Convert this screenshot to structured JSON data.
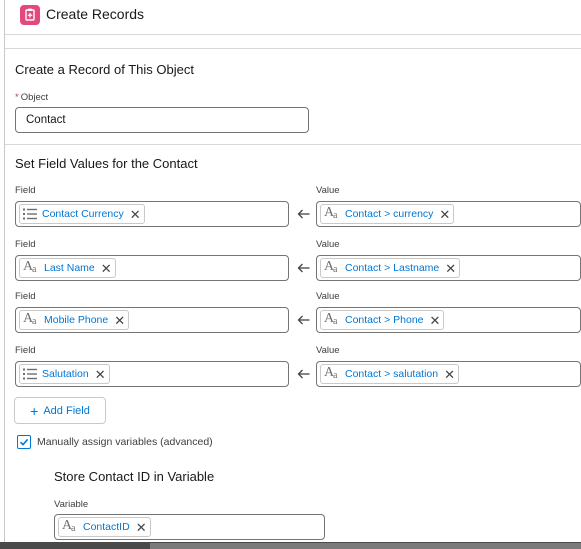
{
  "header": {
    "title": "Create Records",
    "icon": "create-records-icon",
    "icon_color": "#e5477f"
  },
  "object_section": {
    "title": "Create a Record of This Object",
    "object_label": "Object",
    "required_marker": "*",
    "object_value": "Contact"
  },
  "fields_section": {
    "title": "Set Field Values for the Contact",
    "field_label": "Field",
    "value_label": "Value",
    "rows": [
      {
        "field": "Contact Currency",
        "field_icon": "picklist-icon",
        "value": "Contact > currency",
        "value_icon": "text-icon"
      },
      {
        "field": "Last Name",
        "field_icon": "text-icon",
        "value": "Contact > Lastname",
        "value_icon": "text-icon"
      },
      {
        "field": "Mobile Phone",
        "field_icon": "text-icon",
        "value": "Contact > Phone",
        "value_icon": "text-icon"
      },
      {
        "field": "Salutation",
        "field_icon": "picklist-icon",
        "value": "Contact > salutation",
        "value_icon": "text-icon"
      }
    ],
    "add_field_label": "Add Field"
  },
  "manual_assign": {
    "label": "Manually assign variables (advanced)",
    "checked": true
  },
  "store_section": {
    "title": "Store Contact ID in Variable",
    "variable_label": "Variable",
    "variable_value": "ContactID"
  },
  "colors": {
    "link_blue": "#0176d3",
    "required_red": "#c23934",
    "border": "#747474"
  }
}
